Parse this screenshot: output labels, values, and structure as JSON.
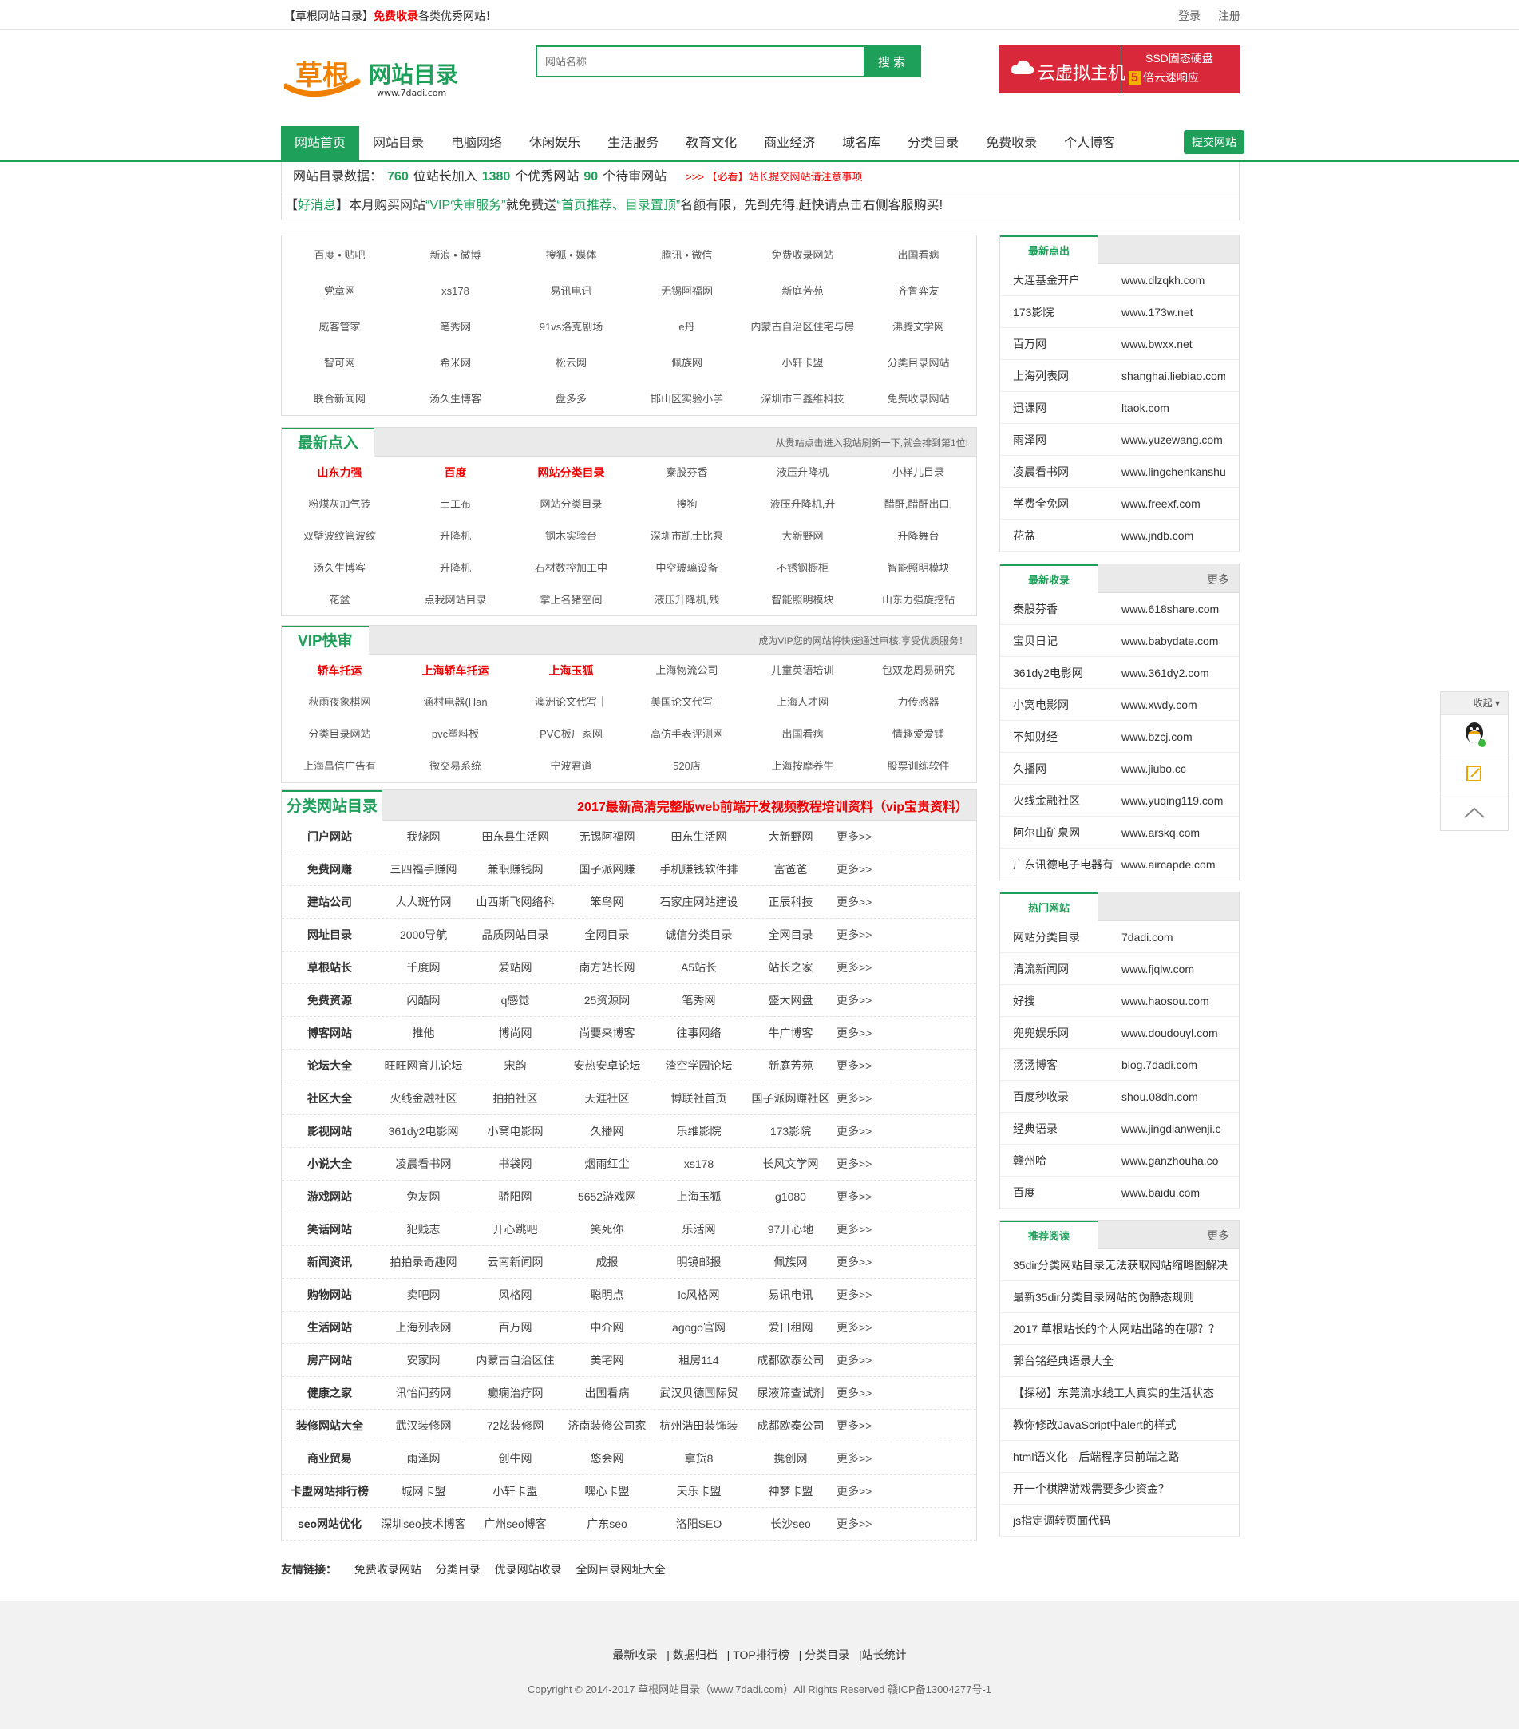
{
  "topbar": {
    "brand": "【草根网站目录】",
    "free": "免费收录",
    "desc": "各类优秀网站！",
    "login": "登录",
    "register": "注册"
  },
  "logo": {
    "main": "草根",
    "sub": "网站目录",
    "url": "www.7dadi.com"
  },
  "search": {
    "placeholder": "网站名称",
    "button": "搜 索"
  },
  "ad": {
    "title": "云虚拟主机",
    "line1": "SSD固态硬盘",
    "num": "5",
    "line2": "倍云速响应"
  },
  "nav": {
    "items": [
      "网站首页",
      "网站目录",
      "电脑网络",
      "休闲娱乐",
      "生活服务",
      "教育文化",
      "商业经济",
      "域名库",
      "分类目录",
      "免费收录",
      "个人博客"
    ],
    "submit": "提交网站"
  },
  "stats": {
    "label": "网站目录数据：",
    "sites": "760",
    "sites_text": "位站长加入",
    "good": "1380",
    "good_text": "个优秀网站",
    "pending": "90",
    "pending_text": "个待审网站",
    "warn": ">>> 【必看】站长提交网站请注意事项"
  },
  "notice": {
    "a": "【",
    "b": "好消息",
    "c": "】本月购买网站",
    "d": "“VIP快审服务”",
    "e": "就免费送",
    "f": "“首页推荐、目录置顶”",
    "g": "名额有限，先到先得,赶快请点击右侧客服购买!"
  },
  "featured": [
    "百度 • 贴吧",
    "新浪 • 微博",
    "搜狐 • 媒体",
    "腾讯 • 微信",
    "免费收录网站",
    "出国看病",
    "党章网",
    "xs178",
    "易讯电讯",
    "无锡阿福网",
    "新庭芳苑",
    "齐鲁弈友",
    "威客管家",
    "笔秀网",
    "91vs洛克剧场",
    "e丹",
    "内蒙古自治区住宅与房",
    "沸腾文学网",
    "智可网",
    "希米网",
    "松云网",
    "佩族网",
    "小轩卡盟",
    "分类目录网站",
    "联合新闻网",
    "汤久生博客",
    "盘多多",
    "邯山区实验小学",
    "深圳市三鑫维科技",
    "免费收录网站"
  ],
  "latest_in": {
    "title": "最新点入",
    "note": "从贵站点击进入我站刷新一下,就会排到第1位!",
    "items": [
      "山东力强",
      "百度",
      "网站分类目录",
      "秦股芬香",
      "液压升降机",
      "小样儿目录",
      "粉煤灰加气砖",
      "土工布",
      "网站分类目录",
      "搜狗",
      "液压升降机,升",
      "醋酐,醋酐出口,",
      "双壁波纹管波纹",
      "升降机",
      "钢木实验台",
      "深圳市凯士比泵",
      "大新野网",
      "升降舞台",
      "汤久生博客",
      "升降机",
      "石材数控加工中",
      "中空玻璃设备",
      "不锈钢橱柜",
      "智能照明模块",
      "花盆",
      "点我网站目录",
      "掌上名猪空间",
      "液压升降机,残",
      "智能照明模块",
      "山东力强旋挖钻"
    ]
  },
  "vip": {
    "title": "VIP快审",
    "note": "成为VIP您的网站将快速通过审核,享受优质服务！",
    "items": [
      "轿车托运",
      "上海轿车托运",
      "上海玉狐",
      "上海物流公司",
      "儿童英语培训",
      "包双龙周易研究",
      "秋雨夜象棋网",
      "涵村电器(Han",
      "澳洲论文代写｜",
      "美国论文代写｜",
      "上海人才网",
      "力传感器",
      "分类目录网站",
      "pvc塑料板",
      "PVC板厂家网",
      "高仿手表评测网",
      "出国看病",
      "情趣爱爱铺",
      "上海昌信广告有",
      "微交易系统",
      "宁波君道",
      "520店",
      "上海按摩养生",
      "股票训练软件"
    ]
  },
  "cat": {
    "title": "分类网站目录",
    "ad": "2017最新高清完整版web前端开发视频教程培训资料（vip宝贵资料）",
    "more": "更多>>",
    "rows": [
      [
        "门户网站",
        "我烧网",
        "田东县生活网",
        "无锡阿福网",
        "田东生活网",
        "大新野网"
      ],
      [
        "免费网赚",
        "三四福手赚网",
        "兼职赚钱网",
        "国子派网赚",
        "手机赚钱软件排",
        "富爸爸"
      ],
      [
        "建站公司",
        "人人斑竹网",
        "山西斯飞网络科",
        "笨鸟网",
        "石家庄网站建设",
        "正辰科技"
      ],
      [
        "网址目录",
        "2000导航",
        "品质网站目录",
        "全网目录",
        "诚信分类目录",
        "全网目录"
      ],
      [
        "草根站长",
        "千度网",
        "爱站网",
        "南方站长网",
        "A5站长",
        "站长之家"
      ],
      [
        "免费资源",
        "闪酷网",
        "q感觉",
        "25资源网",
        "笔秀网",
        "盛大网盘"
      ],
      [
        "博客网站",
        "推他",
        "博尚网",
        "尚要来博客",
        "往事网络",
        "牛广博客"
      ],
      [
        "论坛大全",
        "旺旺网育儿论坛",
        "宋韵",
        "安热安卓论坛",
        "渣空学园论坛",
        "新庭芳苑"
      ],
      [
        "社区大全",
        "火线金融社区",
        "拍拍社区",
        "天涯社区",
        "博联社首页",
        "国子派网赚社区"
      ],
      [
        "影视网站",
        "361dy2电影网",
        "小窝电影网",
        "久播网",
        "乐维影院",
        "173影院"
      ],
      [
        "小说大全",
        "凌晨看书网",
        "书袋网",
        "烟雨红尘",
        "xs178",
        "长风文学网"
      ],
      [
        "游戏网站",
        "兔友网",
        "骄阳网",
        "5652游戏网",
        "上海玉狐",
        "g1080"
      ],
      [
        "笑话网站",
        "犯贱志",
        "开心跳吧",
        "笑死你",
        "乐活网",
        "97开心地"
      ],
      [
        "新闻资讯",
        "拍拍录奇趣网",
        "云南新闻网",
        "成报",
        "明镜邮报",
        "佩族网"
      ],
      [
        "购物网站",
        "卖吧网",
        "风格网",
        "聪明点",
        "lc风格网",
        "易讯电讯"
      ],
      [
        "生活网站",
        "上海列表网",
        "百万网",
        "中介网",
        "agogo官网",
        "爱日租网"
      ],
      [
        "房产网站",
        "安家网",
        "内蒙古自治区住",
        "美宅网",
        "租房114",
        "成都欧泰公司"
      ],
      [
        "健康之家",
        "讯怡问药网",
        "癫痫治疗网",
        "出国看病",
        "武汉贝德国际贸",
        "尿液筛查试剂"
      ],
      [
        "装修网站大全",
        "武汉装修网",
        "72炫装修网",
        "济南装修公司家",
        "杭州浩田装饰装",
        "成都欧泰公司"
      ],
      [
        "商业贸易",
        "雨泽网",
        "创牛网",
        "悠会网",
        "拿货8",
        "携创网"
      ],
      [
        "卡盟网站排行榜",
        "城网卡盟",
        "小轩卡盟",
        "嘿心卡盟",
        "天乐卡盟",
        "神梦卡盟"
      ],
      [
        "seo网站优化",
        "深圳seo技术博客",
        "广州seo博客",
        "广东seo",
        "洛阳SEO",
        "长沙seo"
      ]
    ]
  },
  "side1": {
    "title": "最新点出",
    "rows": [
      [
        "大连基金开户",
        "www.dlzqkh.com"
      ],
      [
        "173影院",
        "www.173w.net"
      ],
      [
        "百万网",
        "www.bwxx.net"
      ],
      [
        "上海列表网",
        "shanghai.liebiao.com"
      ],
      [
        "迅课网",
        "ltaok.com"
      ],
      [
        "雨泽网",
        "www.yuzewang.com"
      ],
      [
        "凌晨看书网",
        "www.lingchenkanshu"
      ],
      [
        "学费全免网",
        "www.freexf.com"
      ],
      [
        "花盆",
        "www.jndb.com"
      ]
    ]
  },
  "side2": {
    "title": "最新收录",
    "more": "更多",
    "rows": [
      [
        "秦股芬香",
        "www.618share.com"
      ],
      [
        "宝贝日记",
        "www.babydate.com"
      ],
      [
        "361dy2电影网",
        "www.361dy2.com"
      ],
      [
        "小窝电影网",
        "www.xwdy.com"
      ],
      [
        "不知财经",
        "www.bzcj.com"
      ],
      [
        "久播网",
        "www.jiubo.cc"
      ],
      [
        "火线金融社区",
        "www.yuqing119.com"
      ],
      [
        "阿尔山矿泉网",
        "www.arskq.com"
      ],
      [
        "广东讯德电子电器有",
        "www.aircapde.com"
      ]
    ]
  },
  "side3": {
    "title": "热门网站",
    "rows": [
      [
        "网站分类目录",
        "7dadi.com"
      ],
      [
        "清流新闻网",
        "www.fjqlw.com"
      ],
      [
        "好搜",
        "www.haosou.com"
      ],
      [
        "兜兜娱乐网",
        "www.doudouyl.com"
      ],
      [
        "汤汤博客",
        "blog.7dadi.com"
      ],
      [
        "百度秒收录",
        "shou.08dh.com"
      ],
      [
        "经典语录",
        "www.jingdianwenji.c"
      ],
      [
        "赣州哈",
        "www.ganzhouha.co"
      ],
      [
        "百度",
        "www.baidu.com"
      ]
    ]
  },
  "side4": {
    "title": "推荐阅读",
    "more": "更多",
    "rows": [
      "35dir分类网站目录无法获取网站缩略图解决",
      "最新35dir分类目录网站的伪静态规则",
      "2017 草根站长的个人网站出路的在哪？？",
      "郭台铭经典语录大全",
      "【探秘】东莞流水线工人真实的生活状态",
      "教你修改JavaScript中alert的样式",
      "html语义化---后端程序员前端之路",
      "开一个棋牌游戏需要多少资金？",
      "js指定调转页面代码"
    ]
  },
  "friend": {
    "title": "友情链接：",
    "items": [
      "免费收录网站",
      "分类目录",
      "优录网站收录",
      "全网目录网址大全"
    ]
  },
  "footer": {
    "nav": [
      "最新收录",
      "| 数据归档",
      "| TOP排行榜",
      "| 分类目录",
      "|站长统计"
    ],
    "copy": "Copyright © 2014-2017 草根网站目录（www.7dadi.com）All Rights Reserved 赣ICP备13004277号-1"
  },
  "float": {
    "title": "收起"
  },
  "colors": {
    "accent": "#1ea05a",
    "red": "#e00000",
    "ad": "#d9283a"
  }
}
